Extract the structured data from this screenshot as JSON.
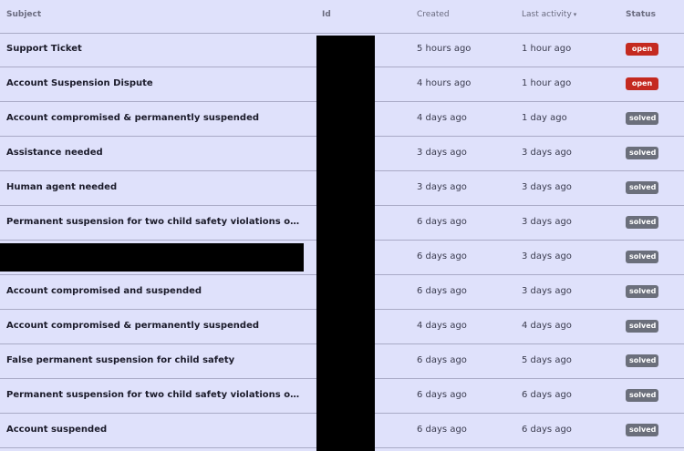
{
  "table": {
    "headers": {
      "subject": "Subject",
      "id": "Id",
      "created": "Created",
      "last_activity": "Last activity",
      "sort_icon": "▾",
      "status": "Status"
    },
    "status_colors": {
      "open": "#c42a20",
      "solved": "#6b6f7b"
    },
    "rows": [
      {
        "subject": "Support Ticket",
        "created": "5 hours ago",
        "last_activity": "1 hour ago",
        "status": "open"
      },
      {
        "subject": "Account Suspension Dispute",
        "created": "4 hours ago",
        "last_activity": "1 hour ago",
        "status": "open"
      },
      {
        "subject": "Account compromised & permanently suspended",
        "created": "4 days ago",
        "last_activity": "1 day ago",
        "status": "solved"
      },
      {
        "subject": "Assistance needed",
        "created": "3 days ago",
        "last_activity": "3 days ago",
        "status": "solved"
      },
      {
        "subject": "Human agent needed",
        "created": "3 days ago",
        "last_activity": "3 days ago",
        "status": "solved"
      },
      {
        "subject": "Permanent suspension for two child safety violations out of nowhere...",
        "created": "6 days ago",
        "last_activity": "3 days ago",
        "status": "solved"
      },
      {
        "subject": "",
        "created": "6 days ago",
        "last_activity": "3 days ago",
        "status": "solved"
      },
      {
        "subject": "Account compromised and suspended",
        "created": "6 days ago",
        "last_activity": "3 days ago",
        "status": "solved"
      },
      {
        "subject": "Account compromised & permanently suspended",
        "created": "4 days ago",
        "last_activity": "4 days ago",
        "status": "solved"
      },
      {
        "subject": "False permanent suspension for child safety",
        "created": "6 days ago",
        "last_activity": "5 days ago",
        "status": "solved"
      },
      {
        "subject": "Permanent suspension for two child safety violations out of nowhere...",
        "created": "6 days ago",
        "last_activity": "6 days ago",
        "status": "solved"
      },
      {
        "subject": "Account suspended",
        "created": "6 days ago",
        "last_activity": "6 days ago",
        "status": "solved"
      }
    ]
  }
}
